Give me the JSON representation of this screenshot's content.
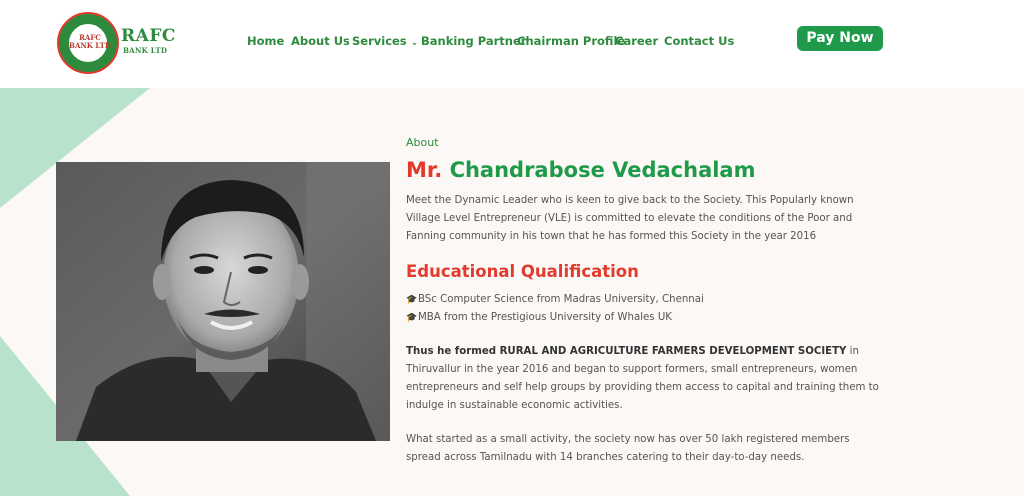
{
  "brand": {
    "name": "RAFC",
    "sub": "BANK LTD",
    "seal_text": "RAFC BANK LTD"
  },
  "nav": {
    "home": "Home",
    "about": "About Us",
    "services": "Services",
    "banking": "Banking Partner",
    "chairman": "Chairman Profile",
    "career": "Career",
    "contact": "Contact Us"
  },
  "pay_now": "Pay Now",
  "colors": {
    "brand_green": "#1f9a4a",
    "accent_red": "#e23b2e",
    "decor_green": "#b8e2cb"
  },
  "profile": {
    "eyebrow": "About",
    "title_prefix": "Mr.",
    "title_name": "Chandrabose Vedachalam",
    "intro": "Meet the Dynamic Leader who is keen to give back to the Society. This Popularly known Village Level Entrepreneur (VLE) is committed to elevate the conditions of the Poor and Fanning community in his town that he has formed this Society in the year 2016",
    "edu_heading": "Educational Qualification",
    "edu_items": [
      "BSc Computer Science from Madras University, Chennai",
      "MBA from the Prestigious University of Whales UK"
    ],
    "p2_bold": "Thus he formed RURAL AND AGRICULTURE FARMERS DEVELOPMENT SOCIETY",
    "p2_rest": " in Thiruvallur in the year 2016 and began to support formers, small entrepreneurs, women entrepreneurs and self help groups by providing them access to capital and training them to indulge in sustainable economic activities.",
    "p3": "What started as a small activity, the society now has over 50 lakh registered members spread across Tamilnadu with 14 branches catering to their day-to-day needs."
  }
}
